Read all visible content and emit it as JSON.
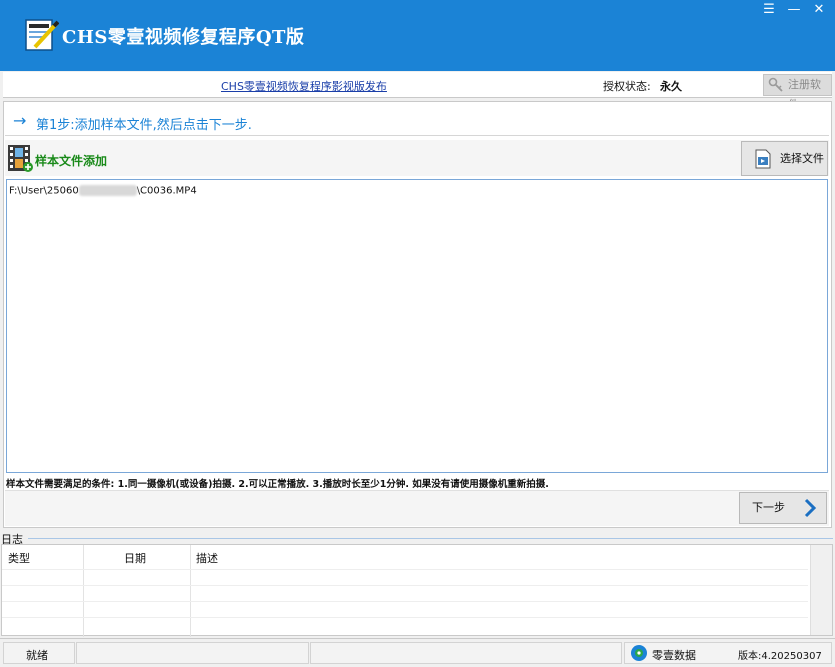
{
  "window": {
    "title": "CHS零壹视频修复程序QT版",
    "menu_glyph": "☰",
    "minimize_glyph": "—",
    "close_glyph": "✕"
  },
  "topbar": {
    "publish_link": "CHS零壹视频恢复程序影视版发布",
    "auth_label": "授权状态:",
    "auth_value": "永久",
    "register_label": "注册软件"
  },
  "step": {
    "arrow": "→",
    "text": "第1步:添加样本文件,然后点击下一步."
  },
  "sample": {
    "section_label": "样本文件添加",
    "choose_button": "选择文件",
    "files": [
      {
        "prefix": "F:\\User\\25060",
        "suffix": "\\C0036.MP4"
      }
    ]
  },
  "requirements": "样本文件需要满足的条件: 1.同一摄像机(或设备)拍摄.  2.可以正常播放.  3.播放时长至少1分钟.  如果没有请使用摄像机重新拍摄.",
  "next_button": "下一步",
  "log": {
    "title": "日志",
    "columns": [
      "类型",
      "日期",
      "描述"
    ]
  },
  "status": {
    "text": "就绪",
    "brand": "零壹数据",
    "version": "版本:4.20250307"
  },
  "colors": {
    "title_bar": "#1b83d6",
    "accent": "#1b83d6",
    "section_green": "#1a8a1a",
    "link": "#1a3ea8"
  }
}
